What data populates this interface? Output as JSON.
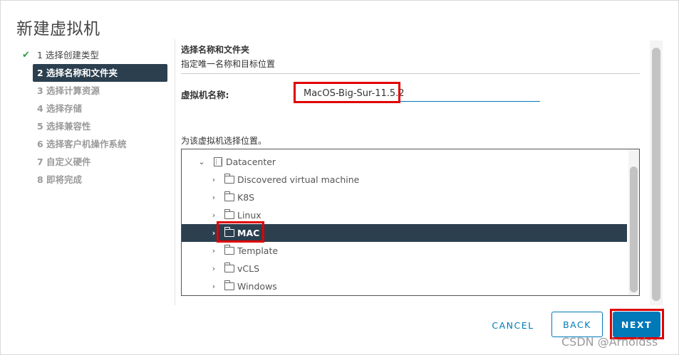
{
  "dialog": {
    "title": "新建虚拟机"
  },
  "steps": [
    {
      "label": "1 选择创建类型",
      "state": "done",
      "icon": "check-icon"
    },
    {
      "label": "2 选择名称和文件夹",
      "state": "active"
    },
    {
      "label": "3 选择计算资源",
      "state": "pending"
    },
    {
      "label": "4 选择存储",
      "state": "pending"
    },
    {
      "label": "5 选择兼容性",
      "state": "pending"
    },
    {
      "label": "6 选择客户机操作系统",
      "state": "pending"
    },
    {
      "label": "7 自定义硬件",
      "state": "pending"
    },
    {
      "label": "8 即将完成",
      "state": "pending"
    }
  ],
  "main": {
    "section_title": "选择名称和文件夹",
    "section_subtitle": "指定唯一名称和目标位置",
    "name_label": "虚拟机名称:",
    "name_value": "MacOS-Big-Sur-11.5.2",
    "location_label": "为该虚拟机选择位置。"
  },
  "tree": {
    "root": {
      "label": "Datacenter",
      "icon": "datacenter-icon",
      "expanded": true
    },
    "items": [
      {
        "label": "Discovered virtual machine",
        "icon": "folder-icon",
        "selected": false
      },
      {
        "label": "K8S",
        "icon": "folder-icon",
        "selected": false
      },
      {
        "label": "Linux",
        "icon": "folder-icon",
        "selected": false
      },
      {
        "label": "MAC",
        "icon": "folder-icon",
        "selected": true
      },
      {
        "label": "Template",
        "icon": "folder-icon",
        "selected": false
      },
      {
        "label": "vCLS",
        "icon": "folder-icon",
        "selected": false
      },
      {
        "label": "Windows",
        "icon": "folder-icon",
        "selected": false
      }
    ]
  },
  "footer": {
    "cancel_label": "CANCEL",
    "back_label": "BACK",
    "next_label": "NEXT"
  },
  "watermark": "CSDN @Arnoldss",
  "colors": {
    "accent": "#0079b8",
    "selected_bg": "#2b3f4f",
    "highlight": "#e00000",
    "check": "#2f9e44"
  }
}
